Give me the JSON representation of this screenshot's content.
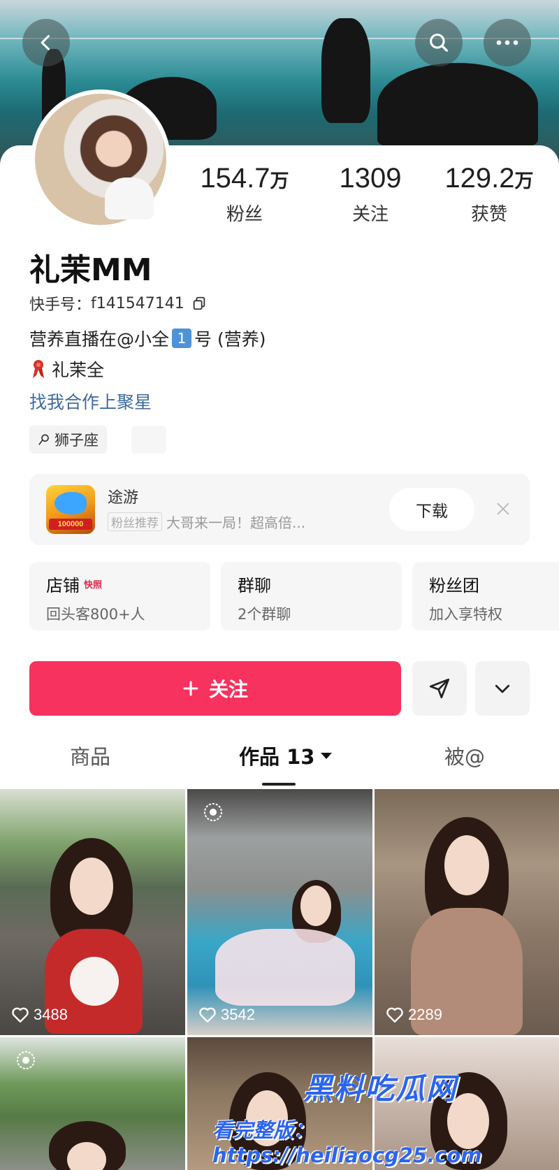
{
  "header": {
    "back_icon": "chevron-left-icon",
    "search_icon": "search-icon",
    "more_icon": "more-dots-icon"
  },
  "profile": {
    "stats": [
      {
        "num": "154.7",
        "unit": "万",
        "label": "粉丝"
      },
      {
        "num": "1309",
        "unit": "",
        "label": "关注"
      },
      {
        "num": "129.2",
        "unit": "万",
        "label": "获赞"
      }
    ],
    "name": "礼茉MM",
    "kuaishou_id_label": "快手号：",
    "kuaishou_id": "f141547141",
    "bio_line1_a": "营养直播在@小全",
    "bio_line1_badge": "1",
    "bio_line1_b": "号 (营养)",
    "bio_line2": "礼茉全",
    "collab_link": "找我合作上聚星",
    "tag": "狮子座"
  },
  "ad": {
    "app_badge": "100000",
    "title": "途游",
    "pill": "粉丝推荐",
    "subtitle": "大哥来一局！超高倍...",
    "download_label": "下载"
  },
  "entries": [
    {
      "title": "店铺",
      "mini": "快照",
      "sub": "回头客800+人"
    },
    {
      "title": "群聊",
      "mini": "",
      "sub": "2个群聊"
    },
    {
      "title": "粉丝团",
      "mini": "",
      "sub": "加入享特权"
    }
  ],
  "actions": {
    "follow_label": "关注"
  },
  "tabs": {
    "goods": "商品",
    "works": "作品 13",
    "mentioned": "被@"
  },
  "grid": {
    "likes": [
      "3488",
      "3542",
      "2289"
    ]
  },
  "watermark": {
    "brand": "黑料吃瓜网",
    "url_line": "看完整版：https://heiliaocg25.com"
  },
  "colors": {
    "accent": "#f8325f",
    "link": "#3d6aa0"
  }
}
